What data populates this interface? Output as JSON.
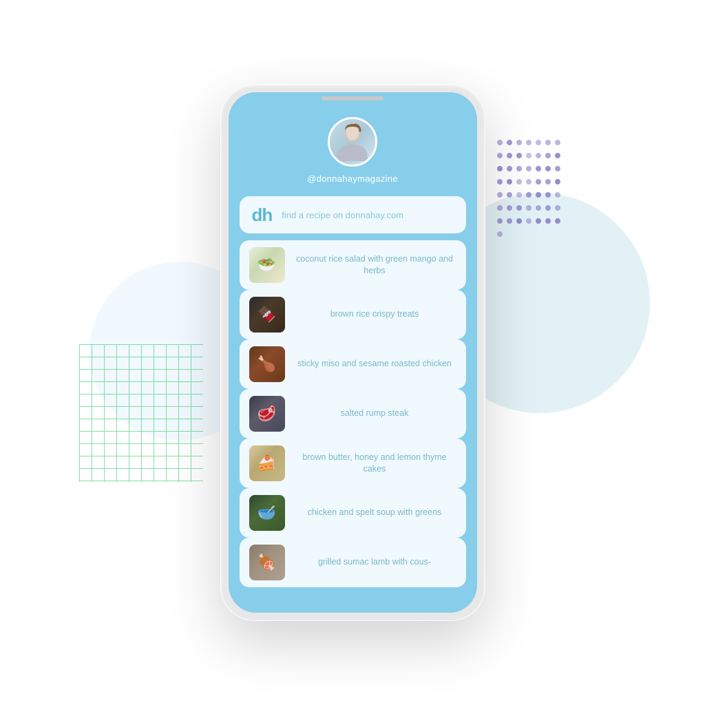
{
  "background": {
    "accent_blue": "#87ceea",
    "accent_light": "#add8e6"
  },
  "profile": {
    "username": "@donnahaymagazine"
  },
  "dh_card": {
    "logo": "dh",
    "link_text": "find a recipe on donnahay.com"
  },
  "recipes": [
    {
      "id": 1,
      "title": "coconut rice salad with green mango and herbs",
      "thumb_class": "thumb-1",
      "icon": "🥗"
    },
    {
      "id": 2,
      "title": "brown rice crispy treats",
      "thumb_class": "thumb-2",
      "icon": "🍫"
    },
    {
      "id": 3,
      "title": "sticky miso and sesame roasted chicken",
      "thumb_class": "thumb-3",
      "icon": "🍗"
    },
    {
      "id": 4,
      "title": "salted rump steak",
      "thumb_class": "thumb-4",
      "icon": "🥩"
    },
    {
      "id": 5,
      "title": "brown butter, honey and lemon thyme cakes",
      "thumb_class": "thumb-5",
      "icon": "🍰"
    },
    {
      "id": 6,
      "title": "chicken and spelt soup with greens",
      "thumb_class": "thumb-6",
      "icon": "🥣"
    },
    {
      "id": 7,
      "title": "grilled sumac lamb with cous-",
      "thumb_class": "thumb-7",
      "icon": "🍖"
    }
  ]
}
